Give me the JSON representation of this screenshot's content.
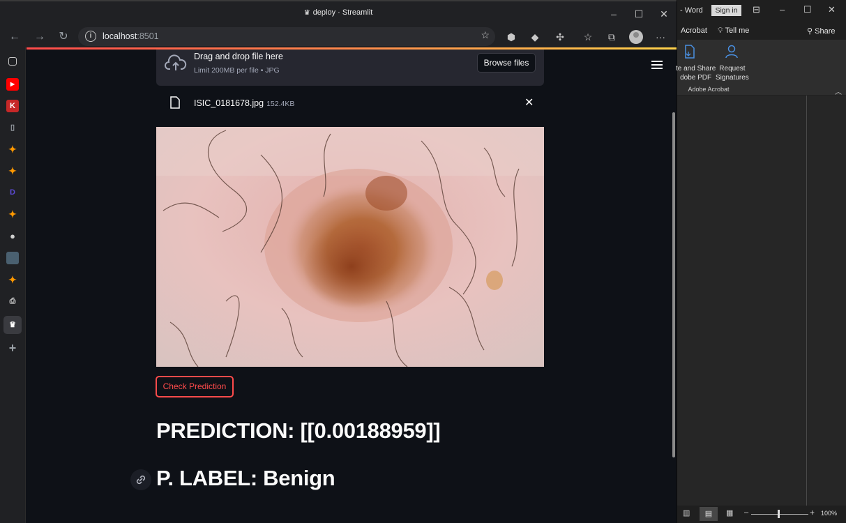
{
  "browser": {
    "window_title": "deploy · Streamlit",
    "url_host": "localhost",
    "url_port": ":8501"
  },
  "uploader": {
    "drop_title": "Drag and drop file here",
    "drop_limit": "Limit 200MB per file • JPG",
    "browse_label": "Browse files"
  },
  "file": {
    "name": "ISIC_0181678.jpg",
    "size": "152.4KB"
  },
  "predict_button": "Check Prediction",
  "prediction_text": "PREDICTION: [[0.00188959]]",
  "label_text": "P. LABEL: Benign",
  "word": {
    "app_name": "- Word",
    "signin": "Sign in",
    "tab_acrobat": "Acrobat",
    "tell_me": "Tell me",
    "share": "Share",
    "ribbon_create_line1": "te and Share",
    "ribbon_create_line2": "dobe PDF",
    "ribbon_request_line1": "Request",
    "ribbon_request_line2": "Signatures",
    "ribbon_group": "Adobe Acrobat",
    "zoom": "100%"
  },
  "colors": {
    "accent": "#ff4b4b",
    "background": "#0e1117",
    "secondary_bg": "#262730"
  }
}
